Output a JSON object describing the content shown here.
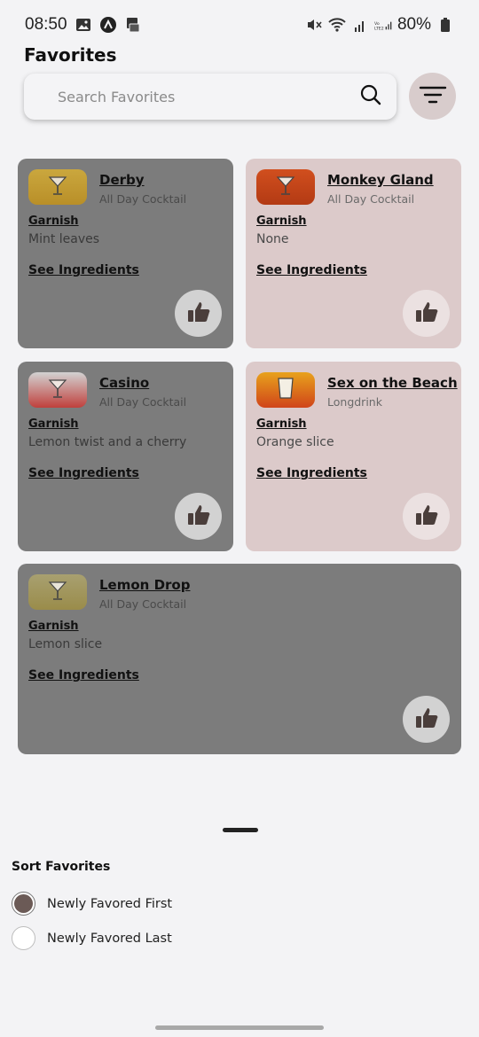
{
  "status_bar": {
    "time": "08:50",
    "battery": "80%",
    "left_icons": [
      "image-icon",
      "nearby-share-icon",
      "cast-icon"
    ],
    "right_icons": [
      "mute-icon",
      "wifi-icon",
      "signal-icon",
      "volte-signal-icon",
      "battery-icon"
    ]
  },
  "header": {
    "title": "Favorites"
  },
  "search": {
    "placeholder": "Search Favorites"
  },
  "cards": [
    {
      "title": "Derby",
      "category": "All Day Cocktail",
      "garnish_label": "Garnish",
      "garnish": "Mint leaves",
      "ingredients_link": "See Ingredients",
      "thumb_color": "#c8a23a",
      "glass": "cocktail"
    },
    {
      "title": "Monkey Gland",
      "category": "All Day Cocktail",
      "garnish_label": "Garnish",
      "garnish": "None",
      "ingredients_link": "See Ingredients",
      "thumb_color": "#c8441c",
      "glass": "cocktail"
    },
    {
      "title": "Casino",
      "category": "All Day Cocktail",
      "garnish_label": "Garnish",
      "garnish": "Lemon twist and a cherry",
      "ingredients_link": "See Ingredients",
      "thumb_color": "#c85050",
      "glass": "cocktail"
    },
    {
      "title": "Sex on the Beach",
      "category": "Longdrink",
      "garnish_label": "Garnish",
      "garnish": "Orange slice",
      "ingredients_link": "See Ingredients",
      "thumb_color": "#e07a1c",
      "glass": "longdrink"
    },
    {
      "title": "Lemon Drop",
      "category": "All Day Cocktail",
      "garnish_label": "Garnish",
      "garnish": "Lemon slice",
      "ingredients_link": "See Ingredients",
      "thumb_color": "#a59a5a",
      "glass": "cocktail"
    }
  ],
  "sort_sheet": {
    "title": "Sort Favorites",
    "options": [
      {
        "label": "Newly Favored First",
        "selected": true
      },
      {
        "label": "Newly Favored Last",
        "selected": false
      }
    ]
  },
  "colors": {
    "accent": "#6b5a56",
    "card_dark": "#7c7c7c",
    "card_pink": "#dccaca"
  }
}
